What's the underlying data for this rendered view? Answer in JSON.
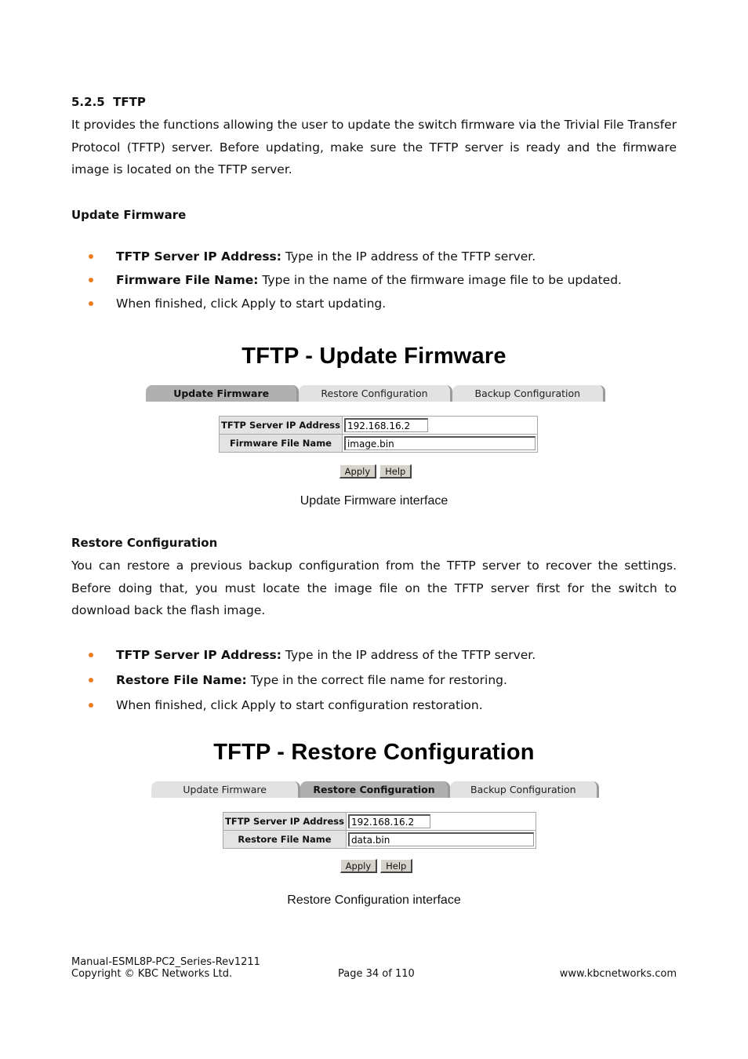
{
  "section": {
    "number": "5.2.5",
    "title": "TFTP",
    "intro": "It provides the functions allowing the user to update the switch firmware via the Trivial File Transfer Protocol (TFTP) server. Before updating, make sure the TFTP server is ready and the firmware image is located on the TFTP server."
  },
  "update": {
    "heading": "Update Firmware",
    "bullets": [
      {
        "bold": "TFTP Server IP Address:",
        "text": " Type in the IP address of the TFTP server."
      },
      {
        "bold": "Firmware File Name:",
        "text": " Type in the name of the firmware image file to be updated."
      },
      {
        "bold": "",
        "text": "When finished, click Apply to start updating."
      }
    ],
    "screenshot": {
      "title": "TFTP - Update Firmware",
      "tabs": [
        "Update Firmware",
        "Restore Configuration",
        "Backup Configuration"
      ],
      "active_tab": 0,
      "rows": [
        {
          "label": "TFTP Server IP Address",
          "value": "192.168.16.2"
        },
        {
          "label": "Firmware File Name",
          "value": "image.bin"
        }
      ],
      "apply": "Apply",
      "help": "Help"
    },
    "caption": "Update Firmware interface"
  },
  "restore": {
    "heading": "Restore Configuration",
    "intro": "You can restore a previous backup configuration from the TFTP server to recover the settings. Before doing that, you must locate the image file on the TFTP server first for the switch to download back the flash image.",
    "bullets": [
      {
        "bold": "TFTP Server IP Address:",
        "text": " Type in the IP address of the TFTP server."
      },
      {
        "bold": "Restore File Name:",
        "text": " Type in the correct file name for restoring."
      },
      {
        "bold": "",
        "text": "When finished, click Apply to start configuration restoration."
      }
    ],
    "screenshot": {
      "title": "TFTP - Restore Configuration",
      "tabs": [
        "Update Firmware",
        "Restore Configuration",
        "Backup Configuration"
      ],
      "active_tab": 1,
      "rows": [
        {
          "label": "TFTP Server IP Address",
          "value": "192.168.16.2"
        },
        {
          "label": "Restore File Name",
          "value": "data.bin"
        }
      ],
      "apply": "Apply",
      "help": "Help"
    },
    "caption": "Restore Configuration interface"
  },
  "footer": {
    "doc_id": "Manual-ESML8P-PC2_Series-Rev1211",
    "copyright": "Copyright © KBC Networks Ltd.",
    "page": "Page 34 of 110",
    "website": "www.kbcnetworks.com"
  },
  "colors": {
    "bullet": "#f07d1e",
    "tab_active": "#b0b0b0",
    "tab_inactive": "#e2e2e2"
  }
}
